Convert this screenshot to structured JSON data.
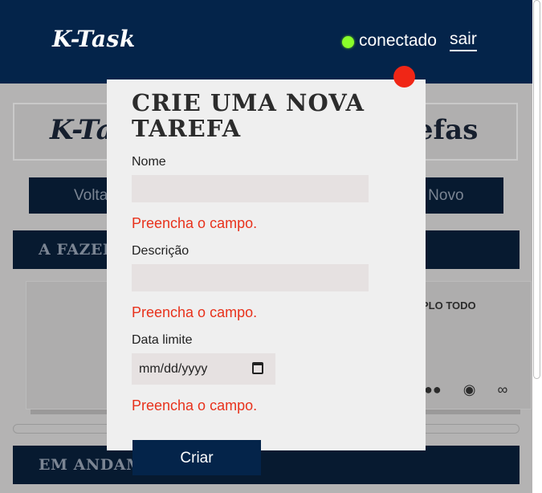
{
  "header": {
    "logo": "K-Task",
    "status": "conectado",
    "logout": "sair",
    "status_color": "#8aff2a"
  },
  "background": {
    "title_left": "K-Ta",
    "title_right": "refas",
    "back_button": "Volta",
    "new_button": "ar Novo",
    "section_todo": "A FAZER",
    "section_doing": "EM ANDAM",
    "task_title": "PLO TODO",
    "task_icons": [
      "people-icon",
      "eye-icon",
      "paperclip-icon"
    ]
  },
  "modal": {
    "title": "CRIE UMA NOVA TAREFA",
    "name_label": "Nome",
    "name_value": "",
    "description_label": "Descrição",
    "description_value": "",
    "deadline_label": "Data limite",
    "deadline_placeholder": "mm/dd/yyyy",
    "error_text": "Preencha o campo.",
    "create_button": "Criar",
    "error_color": "#e8321c",
    "close_color": "#f02616"
  }
}
